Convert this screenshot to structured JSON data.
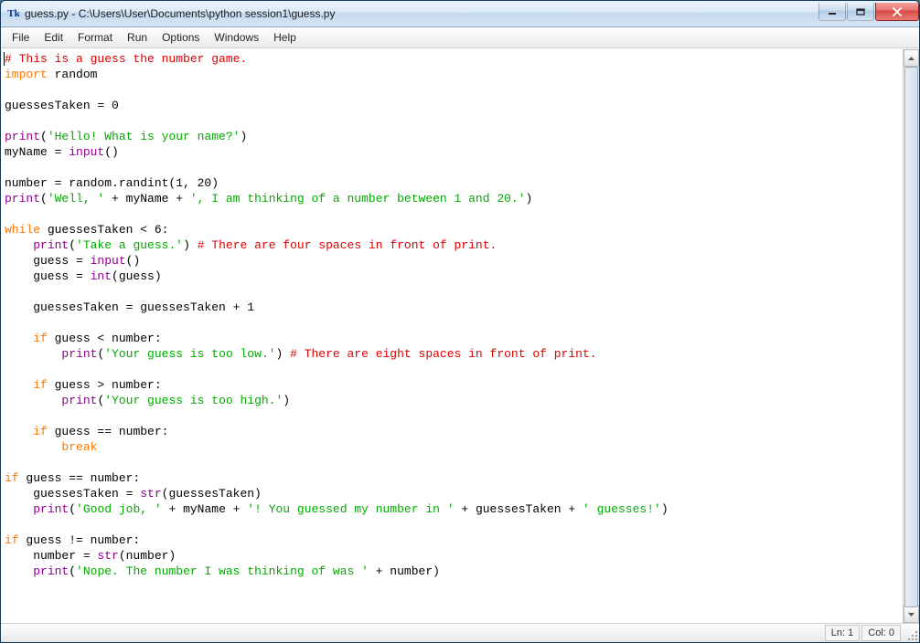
{
  "window": {
    "title": "guess.py - C:\\Users\\User\\Documents\\python session1\\guess.py",
    "icon_glyph": "Tk"
  },
  "menu": {
    "items": [
      "File",
      "Edit",
      "Format",
      "Run",
      "Options",
      "Windows",
      "Help"
    ]
  },
  "status": {
    "ln_label": "Ln: 1",
    "col_label": "Col: 0"
  },
  "code": {
    "lines": [
      [
        {
          "t": "# This is a guess the number game.",
          "c": "c-comment"
        }
      ],
      [
        {
          "t": "import",
          "c": "c-kw"
        },
        {
          "t": " random"
        }
      ],
      [],
      [
        {
          "t": "guessesTaken = 0"
        }
      ],
      [],
      [
        {
          "t": "print",
          "c": "c-builtin"
        },
        {
          "t": "("
        },
        {
          "t": "'Hello! What is your name?'",
          "c": "c-str"
        },
        {
          "t": ")"
        }
      ],
      [
        {
          "t": "myName = "
        },
        {
          "t": "input",
          "c": "c-builtin"
        },
        {
          "t": "()"
        }
      ],
      [],
      [
        {
          "t": "number = random.randint(1, 20)"
        }
      ],
      [
        {
          "t": "print",
          "c": "c-builtin"
        },
        {
          "t": "("
        },
        {
          "t": "'Well, '",
          "c": "c-str"
        },
        {
          "t": " + myName + "
        },
        {
          "t": "', I am thinking of a number between 1 and 20.'",
          "c": "c-str"
        },
        {
          "t": ")"
        }
      ],
      [],
      [
        {
          "t": "while",
          "c": "c-kw"
        },
        {
          "t": " guessesTaken < 6:"
        }
      ],
      [
        {
          "t": "    "
        },
        {
          "t": "print",
          "c": "c-builtin"
        },
        {
          "t": "("
        },
        {
          "t": "'Take a guess.'",
          "c": "c-str"
        },
        {
          "t": ") "
        },
        {
          "t": "# There are four spaces in front of print.",
          "c": "c-comment"
        }
      ],
      [
        {
          "t": "    guess = "
        },
        {
          "t": "input",
          "c": "c-builtin"
        },
        {
          "t": "()"
        }
      ],
      [
        {
          "t": "    guess = "
        },
        {
          "t": "int",
          "c": "c-builtin"
        },
        {
          "t": "(guess)"
        }
      ],
      [],
      [
        {
          "t": "    guessesTaken = guessesTaken + 1"
        }
      ],
      [],
      [
        {
          "t": "    "
        },
        {
          "t": "if",
          "c": "c-kw"
        },
        {
          "t": " guess < number:"
        }
      ],
      [
        {
          "t": "        "
        },
        {
          "t": "print",
          "c": "c-builtin"
        },
        {
          "t": "("
        },
        {
          "t": "'Your guess is too low.'",
          "c": "c-str"
        },
        {
          "t": ") "
        },
        {
          "t": "# There are eight spaces in front of print.",
          "c": "c-comment"
        }
      ],
      [],
      [
        {
          "t": "    "
        },
        {
          "t": "if",
          "c": "c-kw"
        },
        {
          "t": " guess > number:"
        }
      ],
      [
        {
          "t": "        "
        },
        {
          "t": "print",
          "c": "c-builtin"
        },
        {
          "t": "("
        },
        {
          "t": "'Your guess is too high.'",
          "c": "c-str"
        },
        {
          "t": ")"
        }
      ],
      [],
      [
        {
          "t": "    "
        },
        {
          "t": "if",
          "c": "c-kw"
        },
        {
          "t": " guess == number:"
        }
      ],
      [
        {
          "t": "        "
        },
        {
          "t": "break",
          "c": "c-kw"
        }
      ],
      [],
      [
        {
          "t": "if",
          "c": "c-kw"
        },
        {
          "t": " guess == number:"
        }
      ],
      [
        {
          "t": "    guessesTaken = "
        },
        {
          "t": "str",
          "c": "c-builtin"
        },
        {
          "t": "(guessesTaken)"
        }
      ],
      [
        {
          "t": "    "
        },
        {
          "t": "print",
          "c": "c-builtin"
        },
        {
          "t": "("
        },
        {
          "t": "'Good job, '",
          "c": "c-str"
        },
        {
          "t": " + myName + "
        },
        {
          "t": "'! You guessed my number in '",
          "c": "c-str"
        },
        {
          "t": " + guessesTaken + "
        },
        {
          "t": "' guesses!'",
          "c": "c-str"
        },
        {
          "t": ")"
        }
      ],
      [],
      [
        {
          "t": "if",
          "c": "c-kw"
        },
        {
          "t": " guess != number:"
        }
      ],
      [
        {
          "t": "    number = "
        },
        {
          "t": "str",
          "c": "c-builtin"
        },
        {
          "t": "(number)"
        }
      ],
      [
        {
          "t": "    "
        },
        {
          "t": "print",
          "c": "c-builtin"
        },
        {
          "t": "("
        },
        {
          "t": "'Nope. The number I was thinking of was '",
          "c": "c-str"
        },
        {
          "t": " + number)"
        }
      ]
    ]
  }
}
